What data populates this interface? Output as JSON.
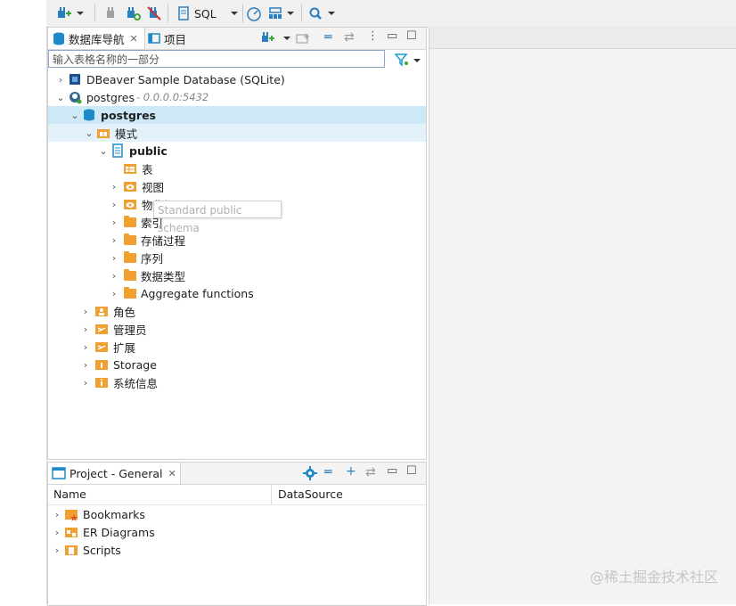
{
  "toolbar": {
    "sql_label": "SQL",
    "icons": [
      "new-connection-icon",
      "disconnect-icon",
      "reconnect-icon",
      "disconnect-all-icon",
      "sql-editor-icon",
      "dashboard-icon",
      "sql-template-icon",
      "search-icon"
    ]
  },
  "navigator": {
    "tab_db": "数据库导航",
    "tab_projects": "项目",
    "filter_placeholder": "输入表格名称的一部分",
    "tree": [
      {
        "label": "DBeaver Sample Database (SQLite)",
        "suffix": ""
      },
      {
        "label": "postgres",
        "suffix": " - 0.0.0.0:5432"
      },
      {
        "label": "postgres"
      },
      {
        "label": "模式"
      },
      {
        "label": "public"
      },
      {
        "label": "表"
      },
      {
        "label": "视图"
      },
      {
        "label": "物化视图"
      },
      {
        "label": "索引"
      },
      {
        "label": "存储过程"
      },
      {
        "label": "序列"
      },
      {
        "label": "数据类型"
      },
      {
        "label": "Aggregate functions"
      },
      {
        "label": "角色"
      },
      {
        "label": "管理员"
      },
      {
        "label": "扩展"
      },
      {
        "label": "Storage"
      },
      {
        "label": "系统信息"
      }
    ],
    "tooltip": "Standard public schema"
  },
  "project": {
    "tab": "Project - General",
    "col_name": "Name",
    "col_datasource": "DataSource",
    "items": [
      {
        "label": "Bookmarks"
      },
      {
        "label": "ER Diagrams"
      },
      {
        "label": "Scripts"
      }
    ]
  },
  "watermark": "@稀土掘金技术社区",
  "colors": {
    "selection": "#cde8f7",
    "folder": "#f0a030",
    "db_blue": "#1e88c8"
  }
}
